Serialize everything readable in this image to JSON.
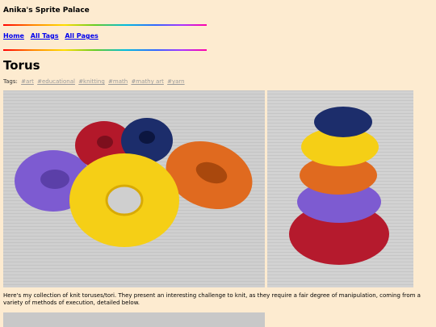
{
  "site": {
    "title": "Anika's Sprite Palace"
  },
  "nav": {
    "home": "Home",
    "all_tags": "All Tags",
    "all_pages": "All Pages"
  },
  "page": {
    "title": "Torus",
    "tags_label": "Tags:",
    "tags": [
      "#art",
      "#educational",
      "#knitting",
      "#math",
      "#mathy art",
      "#yarn"
    ],
    "description": "Here's my collection of knit toruses/tori. They present an interesting challenge to knit, as they require a fair degree of manipulation, coming from a variety of methods of execution, detailed below."
  },
  "colors": {
    "background": "#fdebd0",
    "link": "#0000ee",
    "tag": "#999999"
  }
}
